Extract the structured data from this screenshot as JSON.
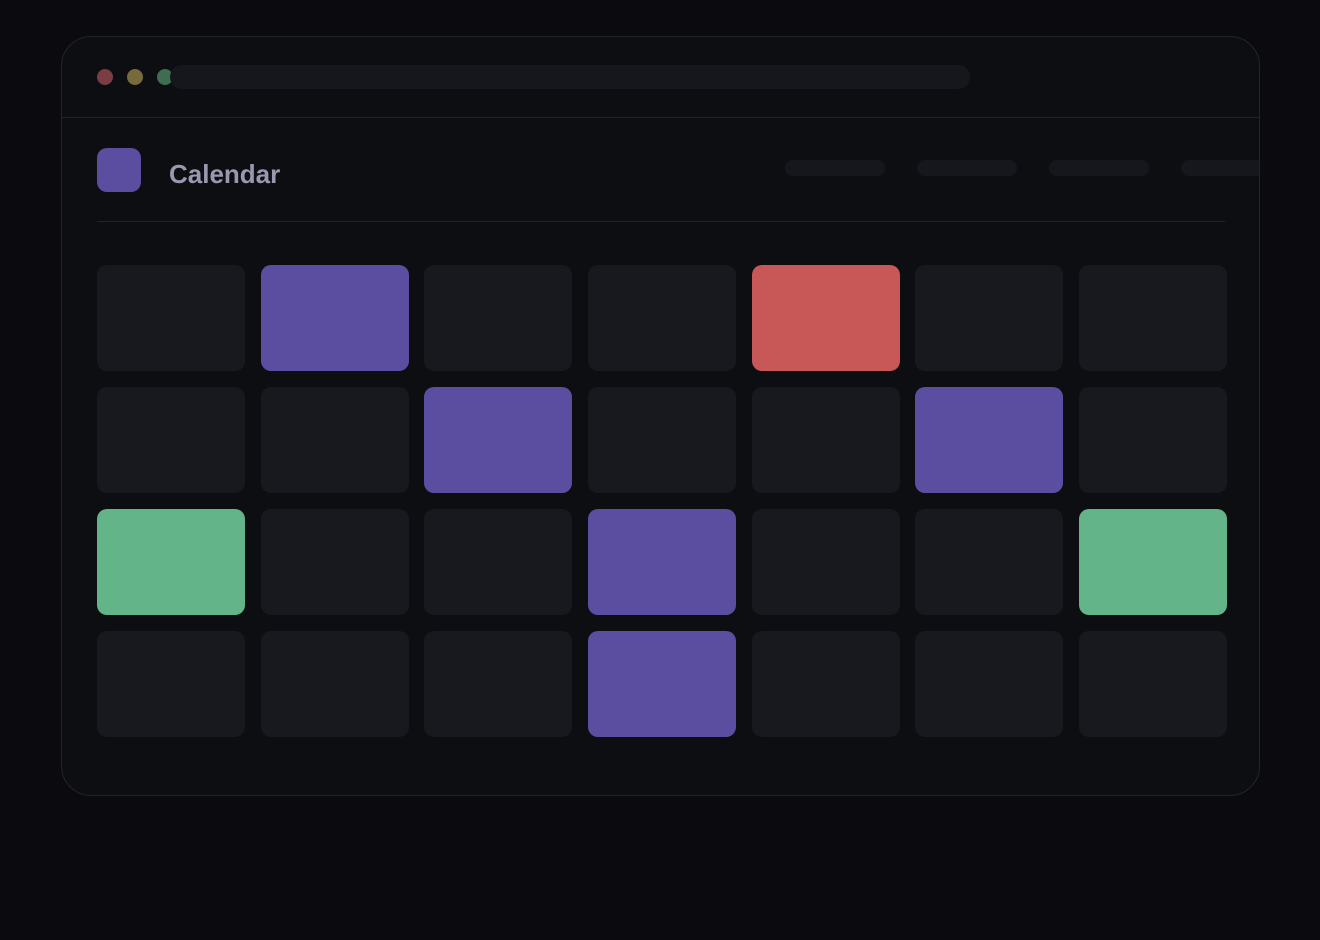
{
  "app": {
    "title": "Calendar"
  },
  "colors": {
    "window_bg": "#0d0e12",
    "empty_cell": "#18181f",
    "purple": "#5b4ea0",
    "red": "#c85757",
    "green": "#63b488",
    "dot_red": "#7a3d44",
    "dot_yellow": "#786a3c",
    "dot_green": "#3e6e52"
  },
  "window_controls": [
    {
      "name": "close",
      "color": "#7a3d44"
    },
    {
      "name": "minimize",
      "color": "#786a3c"
    },
    {
      "name": "maximize",
      "color": "#3e6e52"
    }
  ],
  "nav": {
    "item_count": 4
  },
  "calendar": {
    "columns": 7,
    "rows": [
      [
        "empty",
        "purple",
        "empty",
        "empty",
        "red",
        "empty",
        "empty"
      ],
      [
        "empty",
        "empty",
        "purple",
        "empty",
        "empty",
        "purple",
        "empty"
      ],
      [
        "green",
        "empty",
        "empty",
        "purple",
        "empty",
        "empty",
        "green"
      ],
      [
        "empty",
        "empty",
        "empty",
        "purple",
        "empty",
        "empty",
        "empty"
      ]
    ]
  }
}
